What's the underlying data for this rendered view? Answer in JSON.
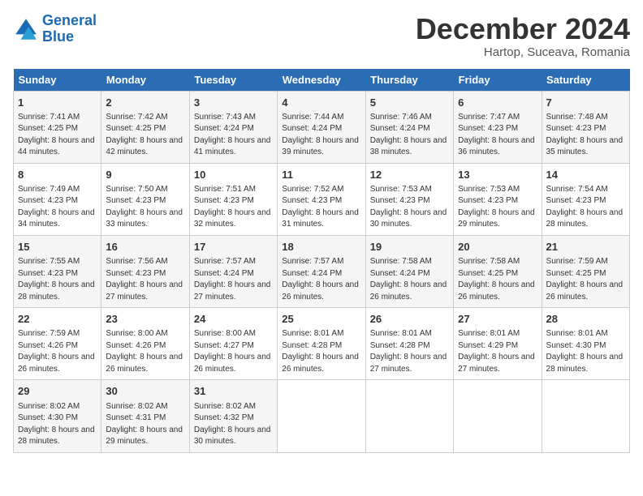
{
  "header": {
    "logo_line1": "General",
    "logo_line2": "Blue",
    "month": "December 2024",
    "location": "Hartop, Suceava, Romania"
  },
  "weekdays": [
    "Sunday",
    "Monday",
    "Tuesday",
    "Wednesday",
    "Thursday",
    "Friday",
    "Saturday"
  ],
  "weeks": [
    [
      {
        "day": "1",
        "sunrise": "7:41 AM",
        "sunset": "4:25 PM",
        "daylight": "8 hours and 44 minutes."
      },
      {
        "day": "2",
        "sunrise": "7:42 AM",
        "sunset": "4:25 PM",
        "daylight": "8 hours and 42 minutes."
      },
      {
        "day": "3",
        "sunrise": "7:43 AM",
        "sunset": "4:24 PM",
        "daylight": "8 hours and 41 minutes."
      },
      {
        "day": "4",
        "sunrise": "7:44 AM",
        "sunset": "4:24 PM",
        "daylight": "8 hours and 39 minutes."
      },
      {
        "day": "5",
        "sunrise": "7:46 AM",
        "sunset": "4:24 PM",
        "daylight": "8 hours and 38 minutes."
      },
      {
        "day": "6",
        "sunrise": "7:47 AM",
        "sunset": "4:23 PM",
        "daylight": "8 hours and 36 minutes."
      },
      {
        "day": "7",
        "sunrise": "7:48 AM",
        "sunset": "4:23 PM",
        "daylight": "8 hours and 35 minutes."
      }
    ],
    [
      {
        "day": "8",
        "sunrise": "7:49 AM",
        "sunset": "4:23 PM",
        "daylight": "8 hours and 34 minutes."
      },
      {
        "day": "9",
        "sunrise": "7:50 AM",
        "sunset": "4:23 PM",
        "daylight": "8 hours and 33 minutes."
      },
      {
        "day": "10",
        "sunrise": "7:51 AM",
        "sunset": "4:23 PM",
        "daylight": "8 hours and 32 minutes."
      },
      {
        "day": "11",
        "sunrise": "7:52 AM",
        "sunset": "4:23 PM",
        "daylight": "8 hours and 31 minutes."
      },
      {
        "day": "12",
        "sunrise": "7:53 AM",
        "sunset": "4:23 PM",
        "daylight": "8 hours and 30 minutes."
      },
      {
        "day": "13",
        "sunrise": "7:53 AM",
        "sunset": "4:23 PM",
        "daylight": "8 hours and 29 minutes."
      },
      {
        "day": "14",
        "sunrise": "7:54 AM",
        "sunset": "4:23 PM",
        "daylight": "8 hours and 28 minutes."
      }
    ],
    [
      {
        "day": "15",
        "sunrise": "7:55 AM",
        "sunset": "4:23 PM",
        "daylight": "8 hours and 28 minutes."
      },
      {
        "day": "16",
        "sunrise": "7:56 AM",
        "sunset": "4:23 PM",
        "daylight": "8 hours and 27 minutes."
      },
      {
        "day": "17",
        "sunrise": "7:57 AM",
        "sunset": "4:24 PM",
        "daylight": "8 hours and 27 minutes."
      },
      {
        "day": "18",
        "sunrise": "7:57 AM",
        "sunset": "4:24 PM",
        "daylight": "8 hours and 26 minutes."
      },
      {
        "day": "19",
        "sunrise": "7:58 AM",
        "sunset": "4:24 PM",
        "daylight": "8 hours and 26 minutes."
      },
      {
        "day": "20",
        "sunrise": "7:58 AM",
        "sunset": "4:25 PM",
        "daylight": "8 hours and 26 minutes."
      },
      {
        "day": "21",
        "sunrise": "7:59 AM",
        "sunset": "4:25 PM",
        "daylight": "8 hours and 26 minutes."
      }
    ],
    [
      {
        "day": "22",
        "sunrise": "7:59 AM",
        "sunset": "4:26 PM",
        "daylight": "8 hours and 26 minutes."
      },
      {
        "day": "23",
        "sunrise": "8:00 AM",
        "sunset": "4:26 PM",
        "daylight": "8 hours and 26 minutes."
      },
      {
        "day": "24",
        "sunrise": "8:00 AM",
        "sunset": "4:27 PM",
        "daylight": "8 hours and 26 minutes."
      },
      {
        "day": "25",
        "sunrise": "8:01 AM",
        "sunset": "4:28 PM",
        "daylight": "8 hours and 26 minutes."
      },
      {
        "day": "26",
        "sunrise": "8:01 AM",
        "sunset": "4:28 PM",
        "daylight": "8 hours and 27 minutes."
      },
      {
        "day": "27",
        "sunrise": "8:01 AM",
        "sunset": "4:29 PM",
        "daylight": "8 hours and 27 minutes."
      },
      {
        "day": "28",
        "sunrise": "8:01 AM",
        "sunset": "4:30 PM",
        "daylight": "8 hours and 28 minutes."
      }
    ],
    [
      {
        "day": "29",
        "sunrise": "8:02 AM",
        "sunset": "4:30 PM",
        "daylight": "8 hours and 28 minutes."
      },
      {
        "day": "30",
        "sunrise": "8:02 AM",
        "sunset": "4:31 PM",
        "daylight": "8 hours and 29 minutes."
      },
      {
        "day": "31",
        "sunrise": "8:02 AM",
        "sunset": "4:32 PM",
        "daylight": "8 hours and 30 minutes."
      },
      null,
      null,
      null,
      null
    ]
  ]
}
